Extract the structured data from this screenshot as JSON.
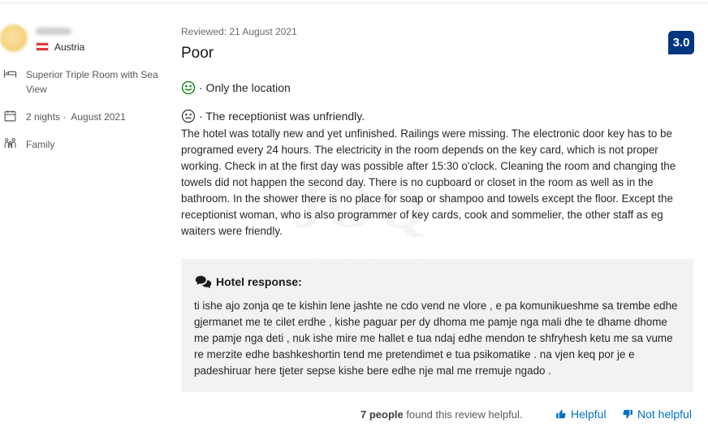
{
  "reviewer": {
    "country": "Austria",
    "flag_colors": [
      "#e03a3e",
      "#ffffff",
      "#e03a3e"
    ]
  },
  "stay": {
    "room": "Superior Triple Room with Sea View",
    "nights": "2 nights ·",
    "month": "August 2021",
    "traveller_type": "Family",
    "icons": [
      "bed-icon",
      "calendar-icon",
      "group-icon"
    ]
  },
  "review": {
    "reviewed_date": "Reviewed: 21 August 2021",
    "title": "Poor",
    "score": "3.0",
    "score_color": "#003580",
    "positive": "· Only the location",
    "negative_intro": "· The receptionist was unfriendly.",
    "body": "The hotel was totally new and yet unfinished. Railings were missing. The electronic door key has to be programed every 24 hours. The electricity in the room depends on the key card, which is not proper working. Check in at the first day was possible after 15:30 o'clock. Cleaning the room and changing the towels did not happen the second day. There is no cupboard or closet in the room as well as in the bathroom. In the shower there is no place for soap or shampoo and towels except the floor. Except the receptionist woman, who is also programmer of key cards, cook and sommelier, the other staff as eg waiters were friendly."
  },
  "watermark": {
    "big": "JOQ",
    "small": "ALBANIA"
  },
  "hotel_response": {
    "label": "Hotel response:",
    "text": "ti ishe ajo zonja qe te kishin lene jashte ne cdo vend ne vlore , e pa komunikueshme sa trembe edhe gjermanet me te cilet erdhe , kishe paguar per dy dhoma me pamje nga mali dhe te dhame dhome me pamje nga deti , nuk ishe mire me hallet e tua ndaj edhe mendon te shfryhesh ketu me sa vume re merzite edhe bashkeshortin tend me pretendimet e tua psikomatike . na vjen keq por je e padeshiruar here tjeter sepse kishe bere edhe nje mal me rremuje ngado ."
  },
  "helpfulness": {
    "count": "7 people",
    "suffix": "found this review helpful.",
    "helpful_label": "Helpful",
    "not_helpful_label": "Not helpful",
    "link_color": "#0071c2"
  }
}
